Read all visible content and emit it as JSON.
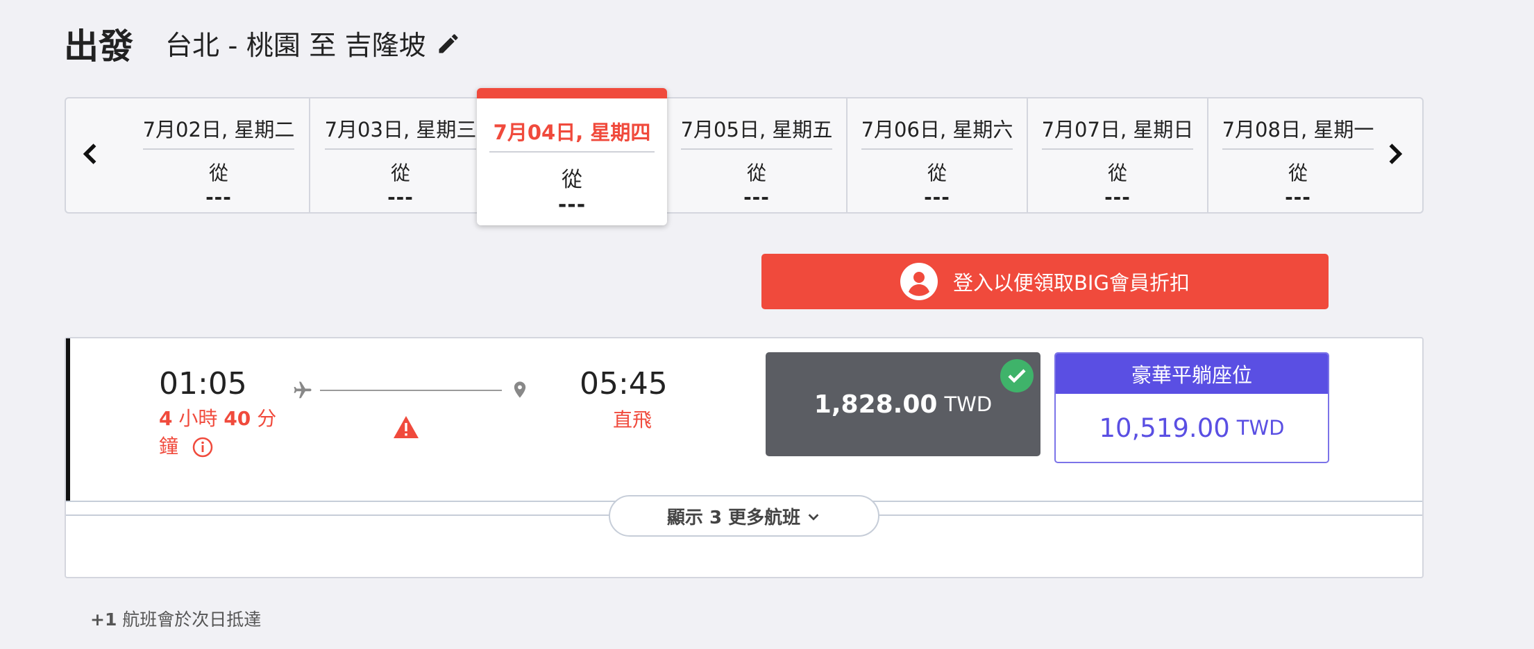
{
  "header": {
    "direction": "出發",
    "route": "台北 - 桃園 至 吉隆坡",
    "edit_icon": "pencil-icon"
  },
  "dates": {
    "prev_icon": "chevron-left-icon",
    "next_icon": "chevron-right-icon",
    "items": [
      {
        "date": "7月02日, 星期二",
        "from": "從",
        "price": "---",
        "selected": false
      },
      {
        "date": "7月03日, 星期三",
        "from": "從",
        "price": "---",
        "selected": false
      },
      {
        "date": "7月04日, 星期四",
        "from": "從",
        "price": "---",
        "selected": true
      },
      {
        "date": "7月05日, 星期五",
        "from": "從",
        "price": "---",
        "selected": false
      },
      {
        "date": "7月06日, 星期六",
        "from": "從",
        "price": "---",
        "selected": false
      },
      {
        "date": "7月07日, 星期日",
        "from": "從",
        "price": "---",
        "selected": false
      },
      {
        "date": "7月08日, 星期一",
        "from": "從",
        "price": "---",
        "selected": false
      }
    ]
  },
  "login_banner": {
    "label": "登入以便領取BIG會員折扣",
    "icon": "user-avatar-icon"
  },
  "flight": {
    "departure_time": "01:05",
    "duration_hours": "4",
    "duration_hours_unit": "小時",
    "duration_minutes": "40",
    "duration_minutes_unit": "分鐘",
    "arrival_time": "05:45",
    "stops": "直飛",
    "fares": {
      "basic": {
        "amount": "1,828.00",
        "currency": "TWD",
        "selected": true
      },
      "flatbed": {
        "title": "豪華平躺座位",
        "amount": "10,519.00",
        "currency": "TWD"
      }
    }
  },
  "show_more": {
    "label": "顯示 3 更多航班"
  },
  "footnote": {
    "marker": "+1",
    "text": "航班會於次日抵達"
  },
  "colors": {
    "accent_red": "#f04a3c",
    "fare_dark": "#5b5d63",
    "flatbed_purple": "#5a4fe3",
    "check_green": "#3fb36a"
  }
}
